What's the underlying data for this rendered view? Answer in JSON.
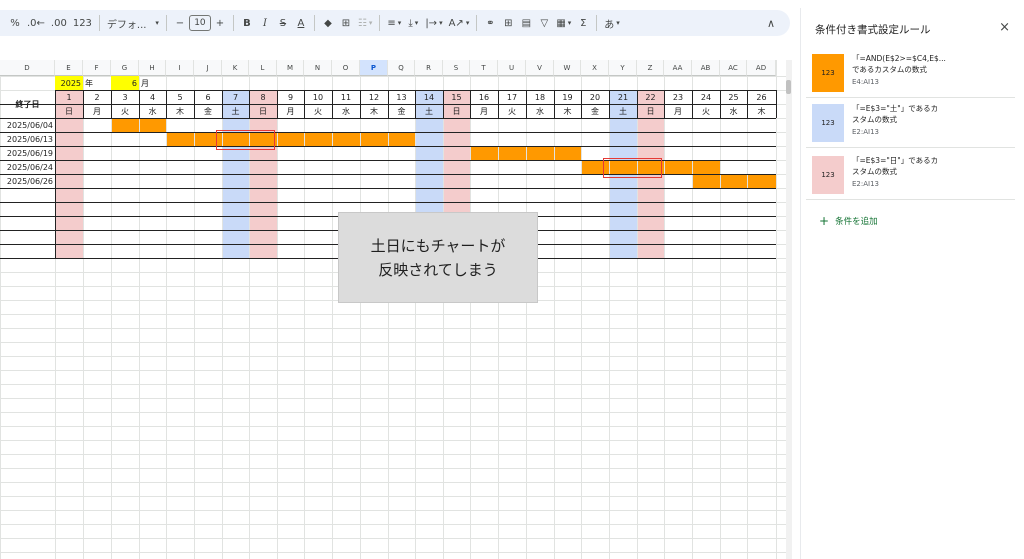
{
  "toolbar": {
    "items": [
      {
        "name": "percent-format-button",
        "label": "%"
      },
      {
        "name": "decrease-decimal-button",
        "label": ".0←"
      },
      {
        "name": "increase-decimal-button",
        "label": ".00"
      },
      {
        "name": "more-formats-button",
        "label": "123"
      },
      {
        "name": "font-family-select",
        "label": "デフォ...",
        "font": true
      },
      {
        "name": "decrease-font-size-button",
        "label": "−"
      },
      {
        "name": "font-size-input",
        "label": "10",
        "size": true
      },
      {
        "name": "increase-font-size-button",
        "label": "+"
      },
      {
        "name": "bold-button",
        "label": "B",
        "cls": "tb-b"
      },
      {
        "name": "italic-button",
        "label": "I",
        "cls": "tb-i"
      },
      {
        "name": "strikethrough-button",
        "label": "S",
        "cls": "tb-s"
      },
      {
        "name": "text-color-button",
        "label": "A",
        "cls": "tb-a"
      },
      {
        "name": "fill-color-icon",
        "label": "◆"
      },
      {
        "name": "borders-icon",
        "label": "⊞"
      },
      {
        "name": "merge-cells-icon",
        "label": "☷",
        "cls": "tb-grey"
      },
      {
        "name": "horizontal-align-icon",
        "label": "≡"
      },
      {
        "name": "vertical-align-icon",
        "label": "⤓"
      },
      {
        "name": "text-wrap-icon",
        "label": "|→"
      },
      {
        "name": "text-rotation-icon",
        "label": "A↗"
      },
      {
        "name": "insert-link-icon",
        "label": "⚭"
      },
      {
        "name": "insert-comment-icon",
        "label": "⊞"
      },
      {
        "name": "insert-chart-icon",
        "label": "▤"
      },
      {
        "name": "filter-icon",
        "label": "▽"
      },
      {
        "name": "filter-views-icon",
        "label": "▦"
      },
      {
        "name": "functions-icon",
        "label": "Σ"
      },
      {
        "name": "input-tools-button",
        "label": "あ"
      }
    ],
    "collapse_icon": "∧"
  },
  "columns": [
    "D",
    "E",
    "F",
    "G",
    "H",
    "I",
    "J",
    "K",
    "L",
    "M",
    "N",
    "O",
    "P",
    "Q",
    "R",
    "S",
    "T",
    "U",
    "V",
    "W",
    "X",
    "Y",
    "Z",
    "AA",
    "AB",
    "AC",
    "AD"
  ],
  "selected_column": "P",
  "header_row": {
    "year": "2025",
    "year_unit": "年",
    "month": "6",
    "month_unit": "月"
  },
  "end_date_label": "終了日",
  "days": [
    "1",
    "2",
    "3",
    "4",
    "5",
    "6",
    "7",
    "8",
    "9",
    "10",
    "11",
    "12",
    "13",
    "14",
    "15",
    "16",
    "17",
    "18",
    "19",
    "20",
    "21",
    "22",
    "23",
    "24",
    "25",
    "26"
  ],
  "weekdays": [
    "日",
    "月",
    "火",
    "水",
    "木",
    "金",
    "土",
    "日",
    "月",
    "火",
    "水",
    "木",
    "金",
    "土",
    "日",
    "月",
    "火",
    "水",
    "木",
    "金",
    "土",
    "日",
    "月",
    "火",
    "水",
    "木"
  ],
  "end_dates": [
    "2025/06/04",
    "2025/06/13",
    "2025/06/19",
    "2025/06/24",
    "2025/06/26"
  ],
  "task_ranges": [
    {
      "start": 3,
      "end": 4
    },
    {
      "start": 5,
      "end": 13
    },
    {
      "start": 16,
      "end": 19
    },
    {
      "start": 20,
      "end": 24
    },
    {
      "start": 24,
      "end": 26
    }
  ],
  "callout": {
    "line1": "土日にもチャートが",
    "line2": "反映されてしまう"
  },
  "panel": {
    "title": "条件付き書式設定ルール",
    "close_icon": "×",
    "rules": [
      {
        "swatch_label": "123",
        "formula": "「=AND(E$2>=$C4,E$...",
        "suffix": "であるカスタムの数式",
        "range": "E4:AI13",
        "color": "#ff9900"
      },
      {
        "swatch_label": "123",
        "formula": "「=E$3=\"土\"」であるカ",
        "suffix": "スタムの数式",
        "range": "E2:AI13",
        "color": "#c9daf8"
      },
      {
        "swatch_label": "123",
        "formula": "「=E$3=\"日\"」であるカ",
        "suffix": "スタムの数式",
        "range": "E2:AI13",
        "color": "#f4cccc"
      }
    ],
    "add_rule_icon": "+",
    "add_rule_label": "条件を追加"
  },
  "colors": {
    "bar": "#ff9900",
    "saturday": "#c9daf8",
    "sunday": "#f4cccc",
    "highlight": "#ffff00",
    "annotation_box": "#e53935"
  }
}
